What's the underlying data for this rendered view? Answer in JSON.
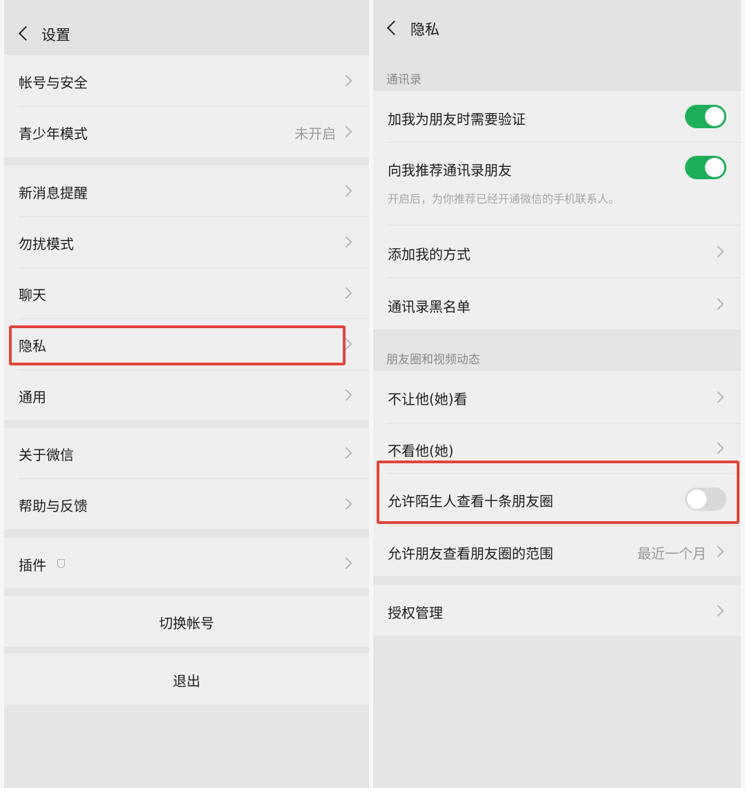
{
  "left": {
    "header_title": "设置",
    "rows": {
      "account": "帐号与安全",
      "teen_mode": "青少年模式",
      "teen_mode_value": "未开启",
      "notifications": "新消息提醒",
      "dnd": "勿扰模式",
      "chat": "聊天",
      "privacy": "隐私",
      "general": "通用",
      "about": "关于微信",
      "help": "帮助与反馈",
      "plugins": "插件"
    },
    "switch_account": "切换帐号",
    "logout": "退出"
  },
  "right": {
    "header_title": "隐私",
    "section_contacts": "通讯录",
    "verify_label": "加我为朋友时需要验证",
    "verify_on": true,
    "recommend_label": "向我推荐通讯录朋友",
    "recommend_on": true,
    "recommend_desc": "开启后，为你推荐已经开通微信的手机联系人。",
    "add_methods": "添加我的方式",
    "blacklist": "通讯录黑名单",
    "section_moments": "朋友圈和视频动态",
    "hide_my_posts": "不让他(她)看",
    "hide_their_posts": "不看他(她)",
    "strangers_label": "允许陌生人查看十条朋友圈",
    "strangers_on": false,
    "visible_range_label": "允许朋友查看朋友圈的范围",
    "visible_range_value": "最近一个月",
    "authorization": "授权管理"
  },
  "colors": {
    "toggle_on": "#1fae5a",
    "highlight": "#e0453a"
  },
  "icons": [
    "back-chevron-icon",
    "chevron-right-icon",
    "shield-icon"
  ]
}
